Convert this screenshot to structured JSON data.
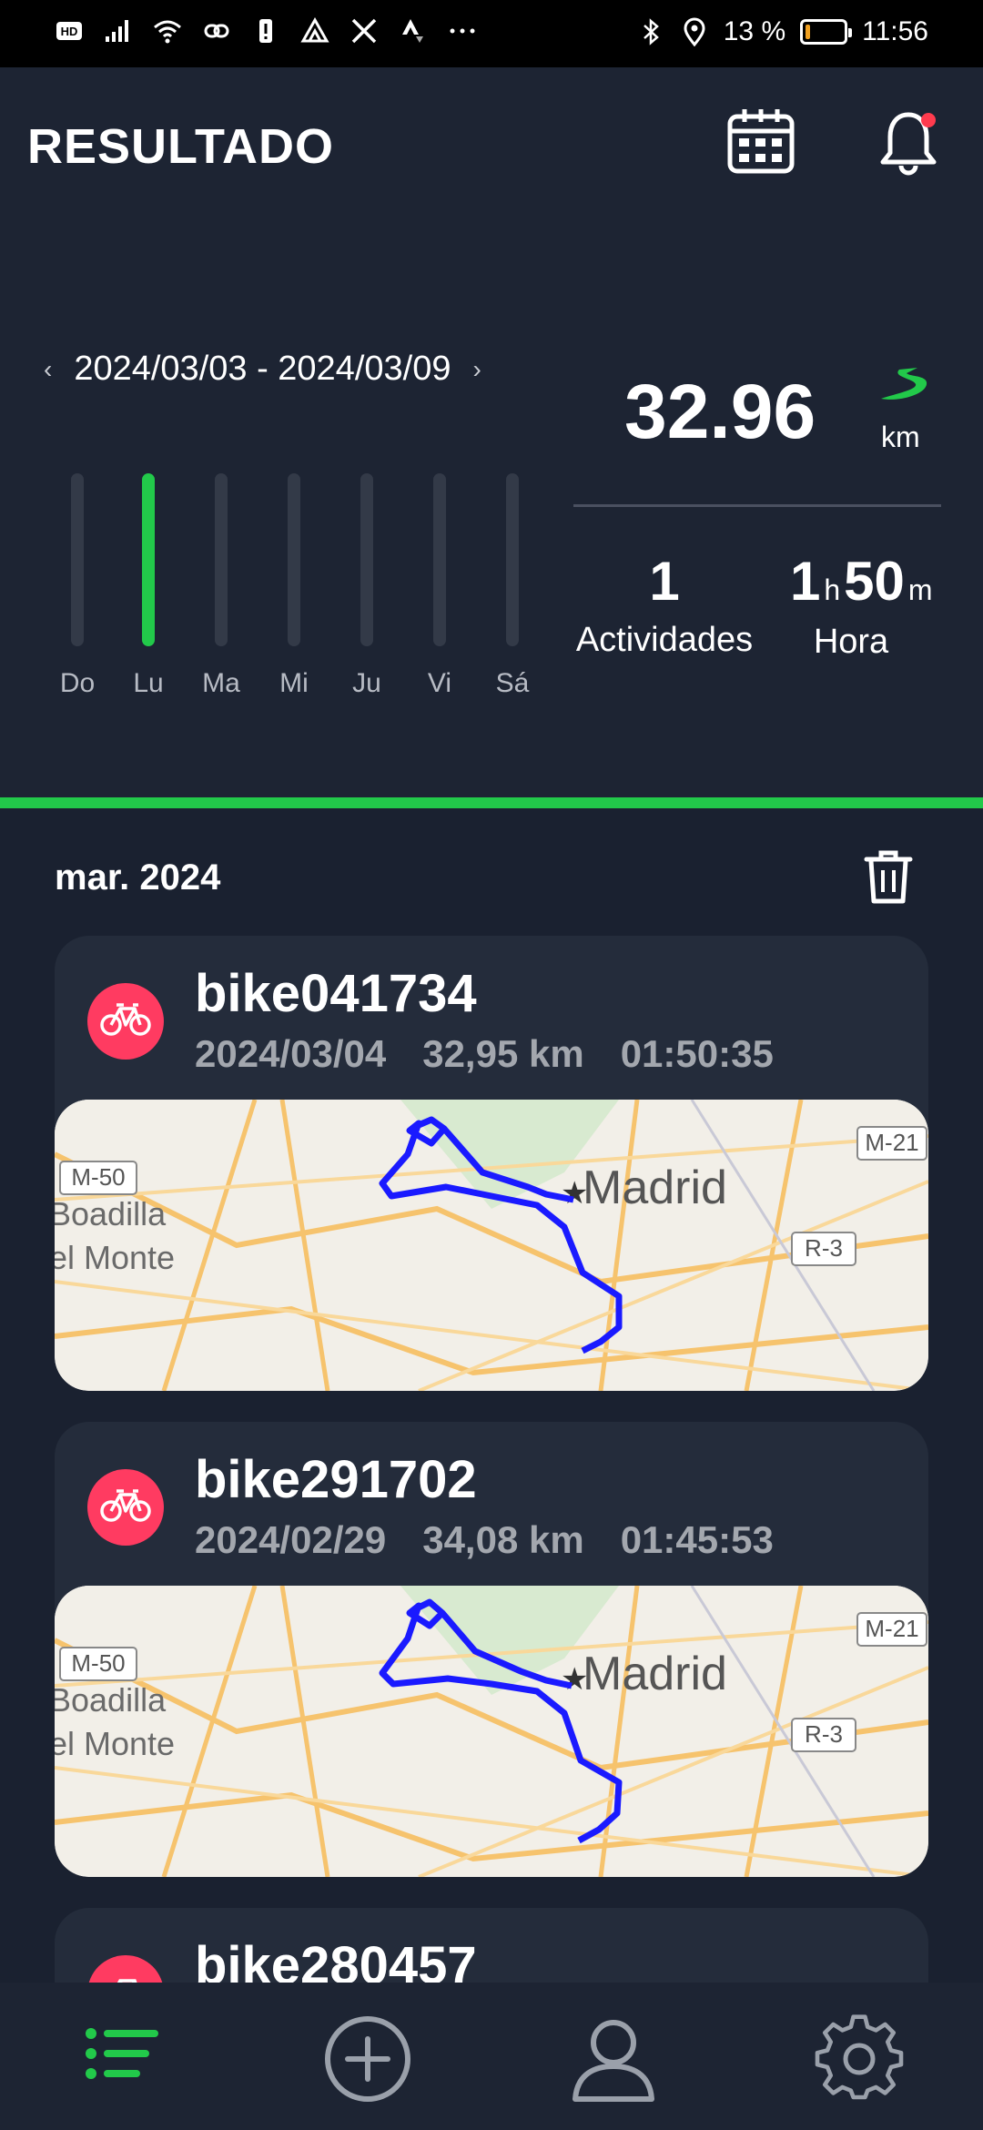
{
  "status_bar": {
    "left_icons": [
      "hd-icon",
      "signal-icon",
      "wifi-icon",
      "link-icon",
      "alert-icon",
      "drive-icon",
      "x-logo-icon",
      "strava-icon",
      "more-dots-icon"
    ],
    "right_icons": [
      "bluetooth-icon",
      "location-icon"
    ],
    "battery_percent": "13 %",
    "battery_level": 0.13,
    "time": "11:56"
  },
  "header": {
    "title": "RESULTADO",
    "calendar_icon": "calendar-icon",
    "bell_icon": "bell-icon",
    "bell_has_badge": true
  },
  "week_summary": {
    "range": "2024/03/03 - 2024/03/09",
    "prev": "‹",
    "next": "›",
    "days": [
      {
        "label": "Do",
        "active": false
      },
      {
        "label": "Lu",
        "active": true
      },
      {
        "label": "Ma",
        "active": false
      },
      {
        "label": "Mi",
        "active": false
      },
      {
        "label": "Ju",
        "active": false
      },
      {
        "label": "Vi",
        "active": false
      },
      {
        "label": "Sá",
        "active": false
      }
    ],
    "distance": "32.96",
    "distance_unit": "km",
    "activities_value": "1",
    "activities_label": "Actividades",
    "time_hours": "1",
    "time_hours_unit": "h",
    "time_minutes": "50",
    "time_minutes_unit": "m",
    "time_label": "Hora"
  },
  "history": {
    "month": "mar. 2024",
    "cards": [
      {
        "name": "bike041734",
        "date": "2024/03/04",
        "distance": "32,95 km",
        "duration": "01:50:35",
        "map_labels": {
          "road1": "M-50",
          "road2": "M-21",
          "road3": "R-3",
          "town": "Boadilla",
          "town2": "el Monte",
          "city": "Madrid"
        }
      },
      {
        "name": "bike291702",
        "date": "2024/02/29",
        "distance": "34,08 km",
        "duration": "01:45:53",
        "map_labels": {
          "road1": "M-50",
          "road2": "M-21",
          "road3": "R-3",
          "town": "Boadilla",
          "town2": "el Monte",
          "city": "Madrid"
        }
      },
      {
        "name": "bike280457"
      }
    ]
  },
  "colors": {
    "accent_green": "#22c94a",
    "bike_red": "#ff3b61",
    "route_blue": "#1a1aff",
    "background": "#1d2433"
  },
  "nav": {
    "items": [
      "list-icon",
      "add-circle-icon",
      "profile-icon",
      "settings-icon"
    ],
    "active": "list-icon"
  }
}
